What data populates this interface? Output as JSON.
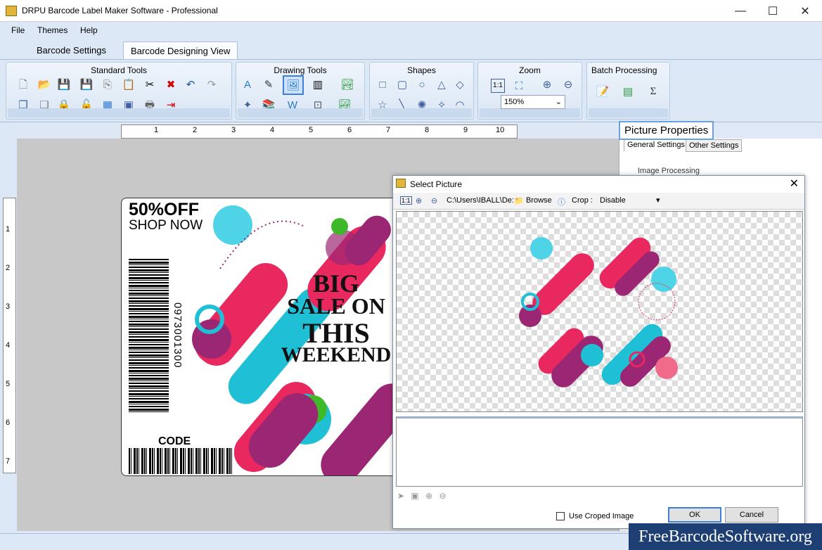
{
  "window": {
    "title": "DRPU Barcode Label Maker Software - Professional",
    "minimize": "—",
    "maximize": "☐",
    "close": "✕"
  },
  "menu": [
    "File",
    "Themes",
    "Help"
  ],
  "tabs": [
    "Barcode Settings",
    "Barcode Designing View"
  ],
  "ribbon": {
    "standard_tools": "Standard Tools",
    "drawing_tools": "Drawing Tools",
    "shapes": "Shapes",
    "zoom": "Zoom",
    "zoom_value": "150%",
    "batch_processing": "Batch Processing",
    "zoom_1to1": "1:1"
  },
  "ruler": {
    "h": [
      "1",
      "2",
      "3",
      "4",
      "5",
      "6",
      "7",
      "8",
      "9",
      "10"
    ],
    "v": [
      "1",
      "2",
      "3",
      "4",
      "5",
      "6",
      "7"
    ]
  },
  "label": {
    "headline": "50%OFF",
    "sub": "SHOP NOW",
    "big1": "BIG",
    "big2": "SALE ON",
    "big3": "THIS",
    "big4": "WEEKEND",
    "barcode_number": "0973001300",
    "code": "CODE"
  },
  "properties": {
    "title": "Picture Properties",
    "tab_general": "General Settings",
    "tab_other": "Other Settings",
    "group": "Image Processing"
  },
  "dialog": {
    "title": "Select Picture",
    "one_to_one": "1:1",
    "path": "C:\\Users\\IBALL\\De:",
    "browse": "Browse",
    "crop_label": "Crop :",
    "crop_value": "Disable",
    "use_cropped": "Use Croped Image",
    "ok": "OK",
    "cancel": "Cancel",
    "close": "✕"
  },
  "watermark": "FreeBarcodeSoftware.org"
}
